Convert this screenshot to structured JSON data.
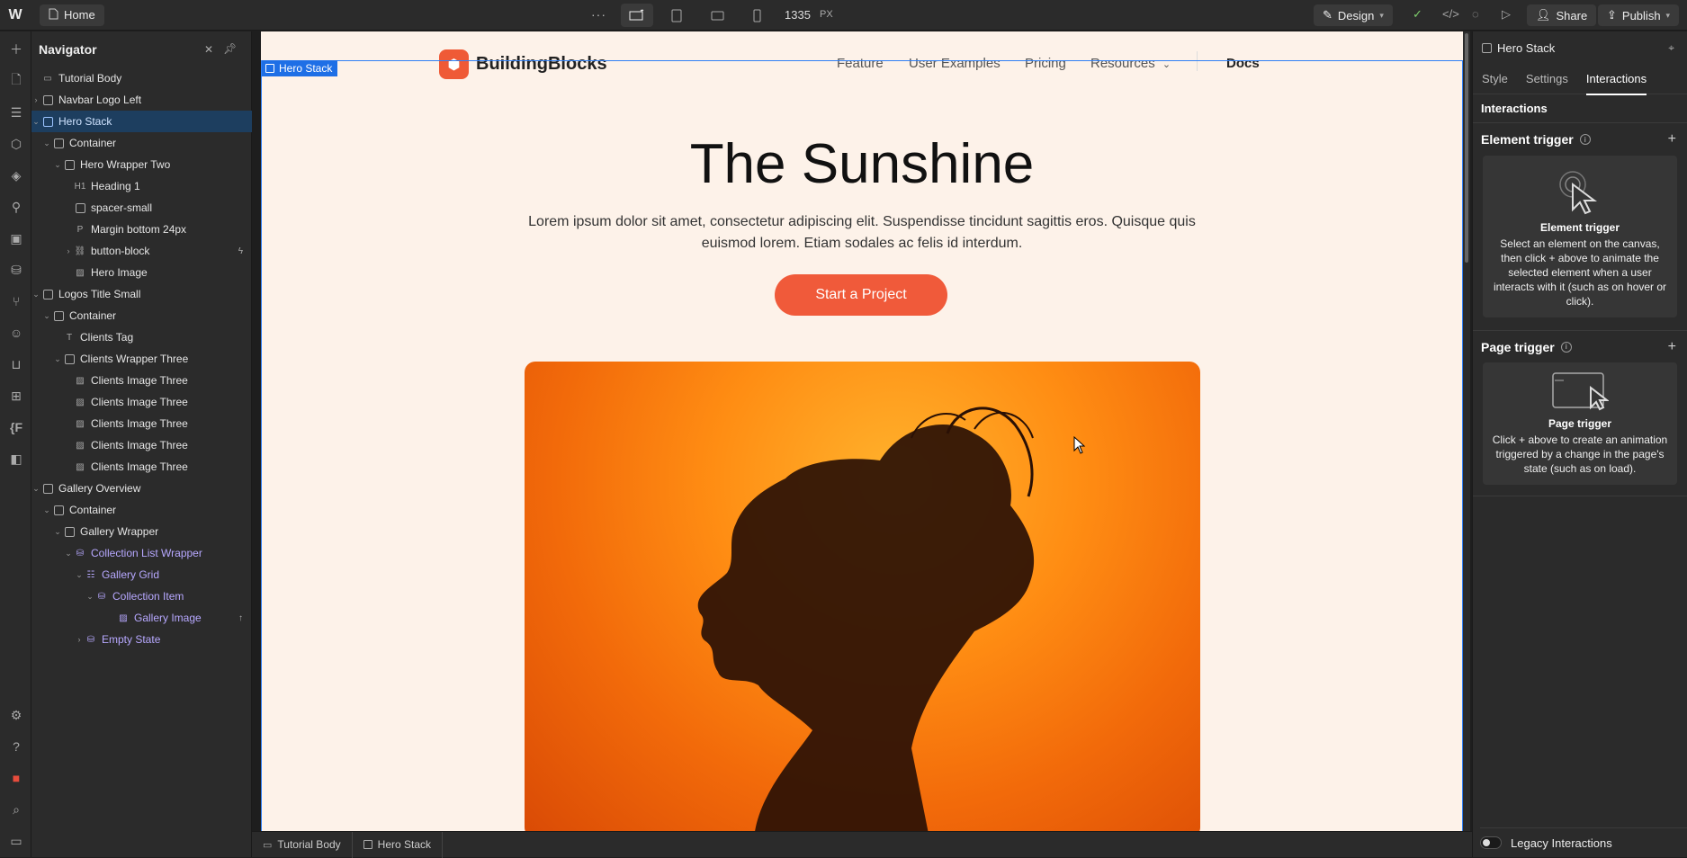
{
  "topbar": {
    "logo": "W",
    "home_label": "Home",
    "more": "···",
    "width_value": "1335",
    "width_unit": "PX",
    "design_label": "Design",
    "share_label": "Share",
    "publish_label": "Publish"
  },
  "navigator": {
    "title": "Navigator",
    "items": [
      {
        "label": "Tutorial Body"
      },
      {
        "label": "Navbar Logo Left"
      },
      {
        "label": "Hero Stack"
      },
      {
        "label": "Container"
      },
      {
        "label": "Hero Wrapper Two"
      },
      {
        "label": "Heading 1",
        "tag": "H1"
      },
      {
        "label": "spacer-small"
      },
      {
        "label": "Margin bottom 24px",
        "tag": "P"
      },
      {
        "label": "button-block"
      },
      {
        "label": "Hero Image"
      },
      {
        "label": "Logos Title Small"
      },
      {
        "label": "Container"
      },
      {
        "label": "Clients Tag",
        "tag": "T"
      },
      {
        "label": "Clients Wrapper Three"
      },
      {
        "label": "Clients Image Three"
      },
      {
        "label": "Clients Image Three"
      },
      {
        "label": "Clients Image Three"
      },
      {
        "label": "Clients Image Three"
      },
      {
        "label": "Clients Image Three"
      },
      {
        "label": "Gallery Overview"
      },
      {
        "label": "Container"
      },
      {
        "label": "Gallery Wrapper"
      },
      {
        "label": "Collection List Wrapper"
      },
      {
        "label": "Gallery Grid"
      },
      {
        "label": "Collection Item"
      },
      {
        "label": "Gallery Image"
      },
      {
        "label": "Empty State"
      }
    ]
  },
  "canvas": {
    "selected_tag": "Hero Stack",
    "brand": "BuildingBlocks",
    "nav": [
      "Feature",
      "User Examples",
      "Pricing",
      "Resources",
      "Docs"
    ],
    "hero_title": "The Sunshine",
    "hero_text": "Lorem ipsum dolor sit amet, consectetur adipiscing elit. Suspendisse tincidunt sagittis eros. Quisque quis euismod lorem. Etiam sodales ac felis id interdum.",
    "cta_label": "Start a Project"
  },
  "right_panel": {
    "element_name": "Hero Stack",
    "tabs": [
      "Style",
      "Settings",
      "Interactions"
    ],
    "active_tab": "Interactions",
    "section_label": "Interactions",
    "element_trigger": {
      "heading": "Element trigger",
      "title": "Element trigger",
      "desc": "Select an element on the canvas, then click + above to animate the selected element when a user interacts with it (such as on hover or click)."
    },
    "page_trigger": {
      "heading": "Page trigger",
      "title": "Page trigger",
      "desc": "Click + above to create an animation triggered by a change in the page's state (such as on load)."
    },
    "legacy_label": "Legacy Interactions"
  },
  "breadcrumbs": [
    "Tutorial Body",
    "Hero Stack"
  ],
  "colors": {
    "accent_blue": "#2f7ff5",
    "brand_orange": "#f05a3a",
    "canvas_bg": "#fdf2e9",
    "ui_dark": "#2b2b2b"
  }
}
